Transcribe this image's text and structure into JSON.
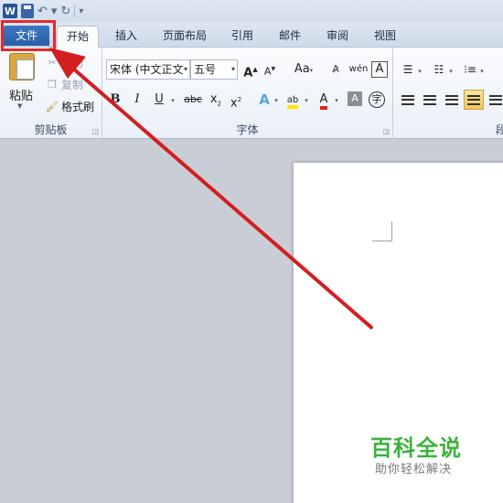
{
  "qat": {
    "word_icon": "W",
    "icons": [
      "word-icon",
      "save-icon",
      "undo-icon",
      "redo-icon",
      "customize-icon"
    ]
  },
  "tabs": {
    "file": "文件",
    "home": "开始",
    "insert": "插入",
    "layout": "页面布局",
    "references": "引用",
    "mailings": "邮件",
    "review": "审阅",
    "view": "视图"
  },
  "clipboard": {
    "paste": "粘贴",
    "cut": "剪切",
    "copy": "复制",
    "format_painter": "格式刷",
    "group_label": "剪贴板"
  },
  "font": {
    "font_name": "宋体 (中文正文",
    "font_size": "五号",
    "grow": "A",
    "shrink": "A",
    "change_case": "Aa",
    "bold": "B",
    "italic": "I",
    "underline": "U",
    "strikethrough": "abc",
    "subscript": "x",
    "superscript": "x",
    "font_color": "A",
    "char_shading": "A",
    "enclose": "字",
    "phonetic": "wén",
    "group_label": "字体"
  },
  "paragraph": {
    "group_label": "段"
  },
  "watermark": {
    "title": "百科全说",
    "subtitle": "助你轻松解决"
  },
  "colors": {
    "accent": "#2a5ea6",
    "highlight_box": "#e32b2b",
    "arrow": "#d21f1f",
    "watermark": "#3bb33b"
  }
}
